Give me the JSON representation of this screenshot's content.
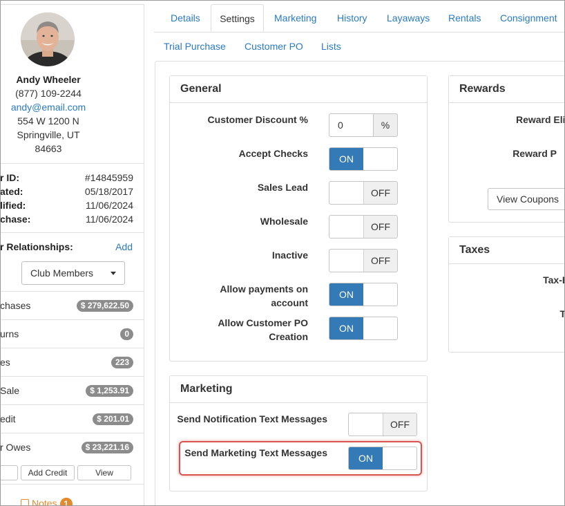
{
  "customer": {
    "name": "Andy Wheeler",
    "phone": "(877) 109-2244",
    "email": "andy@email.com",
    "address1": "554 W 1200 N",
    "city_state": "Springville, UT",
    "zip": "84663"
  },
  "meta": [
    {
      "label": "r ID:",
      "value": "#14845959"
    },
    {
      "label": "ated:",
      "value": "05/18/2017"
    },
    {
      "label": "lified:",
      "value": "11/06/2024"
    },
    {
      "label": "chase:",
      "value": "11/06/2024"
    }
  ],
  "relationships": {
    "label": "r Relationships:",
    "add": "Add",
    "selected": "Club Members"
  },
  "stats": [
    {
      "label": "chases",
      "value": "$ 279,622.50"
    },
    {
      "label": "urns",
      "value": "0"
    },
    {
      "label": "es",
      "value": "223"
    },
    {
      "label": "Sale",
      "value": "$ 1,253.91"
    },
    {
      "label": "edit",
      "value": "$ 201.01"
    },
    {
      "label": "r Owes",
      "value": "$ 23,221.16"
    }
  ],
  "buttons": {
    "add_credit": "Add Credit",
    "view": "View"
  },
  "notes": {
    "label": "Notes",
    "count": "1"
  },
  "tabs": [
    "Details",
    "Settings",
    "Marketing",
    "History",
    "Layaways",
    "Rentals",
    "Consignment",
    "Trial Purchase",
    "Customer PO",
    "Lists"
  ],
  "general": {
    "title": "General",
    "discount": {
      "label": "Customer Discount %",
      "value": "0",
      "addon": "%"
    },
    "settings": [
      {
        "label": "Accept Checks",
        "state": "ON"
      },
      {
        "label": "Sales Lead",
        "state": "OFF"
      },
      {
        "label": "Wholesale",
        "state": "OFF"
      },
      {
        "label": "Inactive",
        "state": "OFF"
      },
      {
        "label_line1": "Allow payments on",
        "label_line2": "account",
        "state": "ON"
      },
      {
        "label_line1": "Allow Customer PO",
        "label_line2": "Creation",
        "state": "ON"
      }
    ]
  },
  "marketing": {
    "title": "Marketing",
    "settings": [
      {
        "label": "Send Notification Text Messages",
        "state": "OFF"
      },
      {
        "label": "Send Marketing Text Messages",
        "state": "ON"
      }
    ]
  },
  "rewards": {
    "title": "Rewards",
    "eligible_label": "Reward Eligi",
    "points_label": "Reward P",
    "coupons_button": "View Coupons"
  },
  "taxes": {
    "title": "Taxes",
    "exempt_label": "Tax-Ex",
    "t_label": "T"
  },
  "colors": {
    "accent": "#337ab7",
    "link": "#2a7ac0",
    "badge": "#8c8c8c",
    "highlight": "#d9534f",
    "notes": "#e58a2c"
  }
}
